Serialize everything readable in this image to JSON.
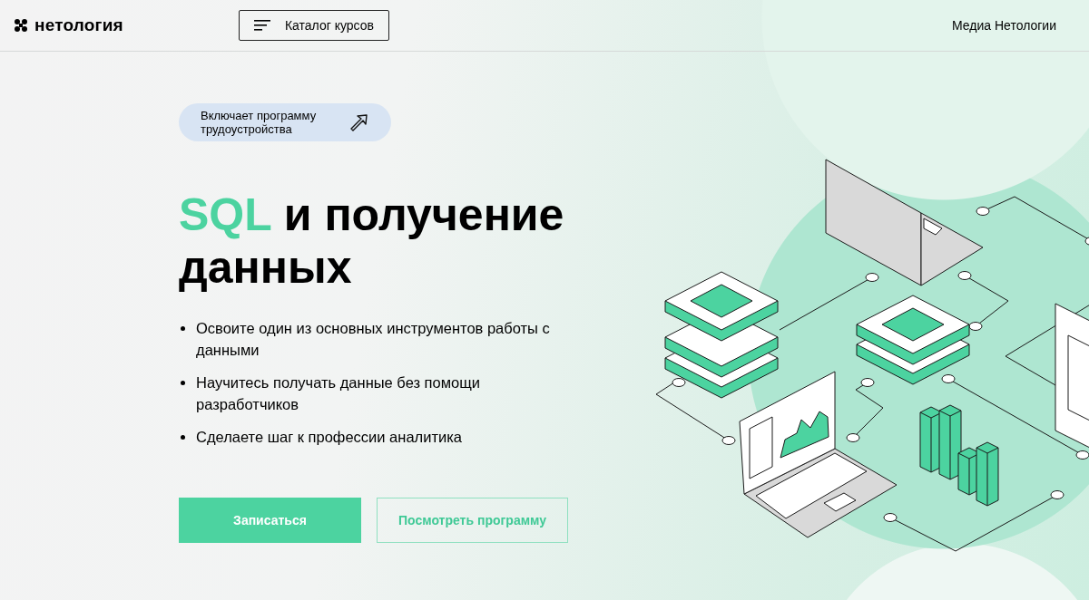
{
  "header": {
    "logo": "нетология",
    "catalog_button": "Каталог курсов",
    "media_link": "Медиа Нетологии"
  },
  "hero": {
    "badge": "Включает программу трудоустройства",
    "title_highlight": "SQL",
    "title_rest": "и получение данных",
    "bullets": [
      "Освоите один из основных инструментов работы с данными",
      "Научитесь получать данные без помощи разработчиков",
      "Сделаете шаг к профессии аналитика"
    ],
    "buttons": [
      {
        "label": "Записаться",
        "kind": "primary"
      },
      {
        "label": "Посмотреть программу",
        "kind": "outline"
      }
    ]
  }
}
